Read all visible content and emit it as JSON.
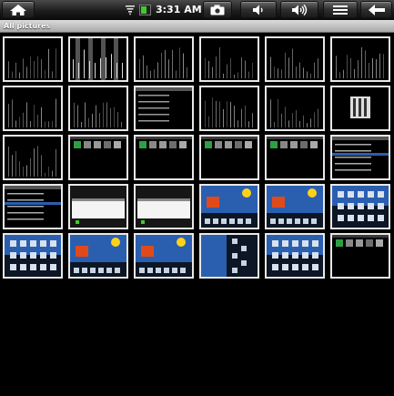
{
  "status_bar": {
    "time": "3:31 AM",
    "icons": [
      "home-icon",
      "wifi-icon",
      "battery-icon",
      "camera-icon",
      "volume-down-icon",
      "volume-up-icon",
      "menu-icon",
      "back-arrow-icon"
    ]
  },
  "gallery": {
    "title": "All pictures",
    "thumbnail_types": [
      "dark-bars",
      "striped-bars",
      "dark-bars",
      "dark-bars",
      "dark-bars",
      "dark-bars",
      "dark-bars",
      "dark-bars",
      "dark-list",
      "dark-bars",
      "dark-bars",
      "white-panel",
      "dark-bars",
      "icon-row",
      "icon-row",
      "icon-row",
      "icon-row",
      "settings-list",
      "settings-list",
      "dialog",
      "dialog",
      "home-screen",
      "home-screen",
      "app-grid",
      "app-grid",
      "home-screen",
      "home-screen",
      "blue-rotated",
      "app-grid",
      "icon-row"
    ]
  },
  "colors": {
    "statusbar": "#1c1c1c",
    "titlebar": "#c0c0c0",
    "thumb_border": "#e8e8e8",
    "sky_blue": "#2a5fb0",
    "accent_orange": "#e04a1a"
  }
}
